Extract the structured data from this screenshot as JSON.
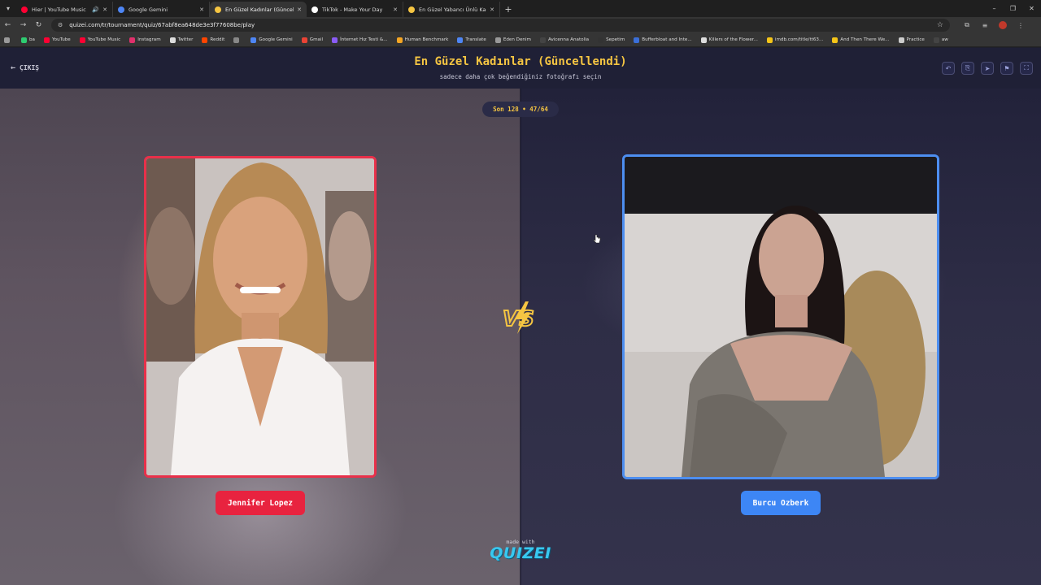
{
  "browser": {
    "tabs": [
      {
        "title": "Hier | YouTube Music",
        "favicon_color": "#ff0033",
        "active": false,
        "audio": true
      },
      {
        "title": "Google Gemini",
        "favicon_color": "#4e86f5",
        "active": false,
        "audio": false
      },
      {
        "title": "En Güzel Kadınlar (Güncellendi)",
        "favicon_color": "#f5c542",
        "active": true,
        "audio": false
      },
      {
        "title": "TikTok - Make Your Day",
        "favicon_color": "#ffffff",
        "active": false,
        "audio": false
      },
      {
        "title": "En Güzel Yabancı Ünlü Kadın -",
        "favicon_color": "#f5c542",
        "active": false,
        "audio": false
      }
    ],
    "url": "quizei.com/tr/tournament/quiz/67abf8ea648de3e3f77608be/play",
    "bookmarks": [
      {
        "label": "ba",
        "color": "#2ecc71"
      },
      {
        "label": "YouTube",
        "color": "#ff0033"
      },
      {
        "label": "YouTube Music",
        "color": "#ff0033"
      },
      {
        "label": "Instagram",
        "color": "#e1306c"
      },
      {
        "label": "Twitter",
        "color": "#dddddd"
      },
      {
        "label": "Reddit",
        "color": "#ff4500"
      },
      {
        "label": "",
        "color": "#888888"
      },
      {
        "label": "Google Gemini",
        "color": "#4e86f5"
      },
      {
        "label": "Gmail",
        "color": "#ea4335"
      },
      {
        "label": "İnternet Hız Testi &...",
        "color": "#8a5cf6"
      },
      {
        "label": "Human Benchmark",
        "color": "#f5a623"
      },
      {
        "label": "Translate",
        "color": "#4e86f5"
      },
      {
        "label": "Eden Denim",
        "color": "#999999"
      },
      {
        "label": "Avicenna Anatolia",
        "color": "#444444"
      },
      {
        "label": "Sepetim",
        "color": "#333333"
      },
      {
        "label": "Bufferbloat and Inte...",
        "color": "#3b6fd8"
      },
      {
        "label": "Killers of the Flower...",
        "color": "#dddddd"
      },
      {
        "label": "imdb.com/title/tt63...",
        "color": "#f5c518"
      },
      {
        "label": "And Then There We...",
        "color": "#f5c518"
      },
      {
        "label": "Practice",
        "color": "#cccccc"
      },
      {
        "label": "aw",
        "color": "#444444"
      }
    ]
  },
  "header": {
    "exit_label": "ÇIKIŞ",
    "title": "En Güzel Kadınlar (Güncellendi)",
    "subtitle": "sadece daha çok beğendiğiniz fotoğrafı seçin"
  },
  "round": {
    "label": "Son 128 • 47/64"
  },
  "contestants": {
    "left": {
      "name": "Jennifer Lopez",
      "accent": "#e8233f"
    },
    "right": {
      "name": "Burcu Ozberk",
      "accent": "#3d86f5"
    }
  },
  "vs_label": "VS",
  "footer": {
    "made_with": "made with",
    "brand": "QUIZEI"
  }
}
